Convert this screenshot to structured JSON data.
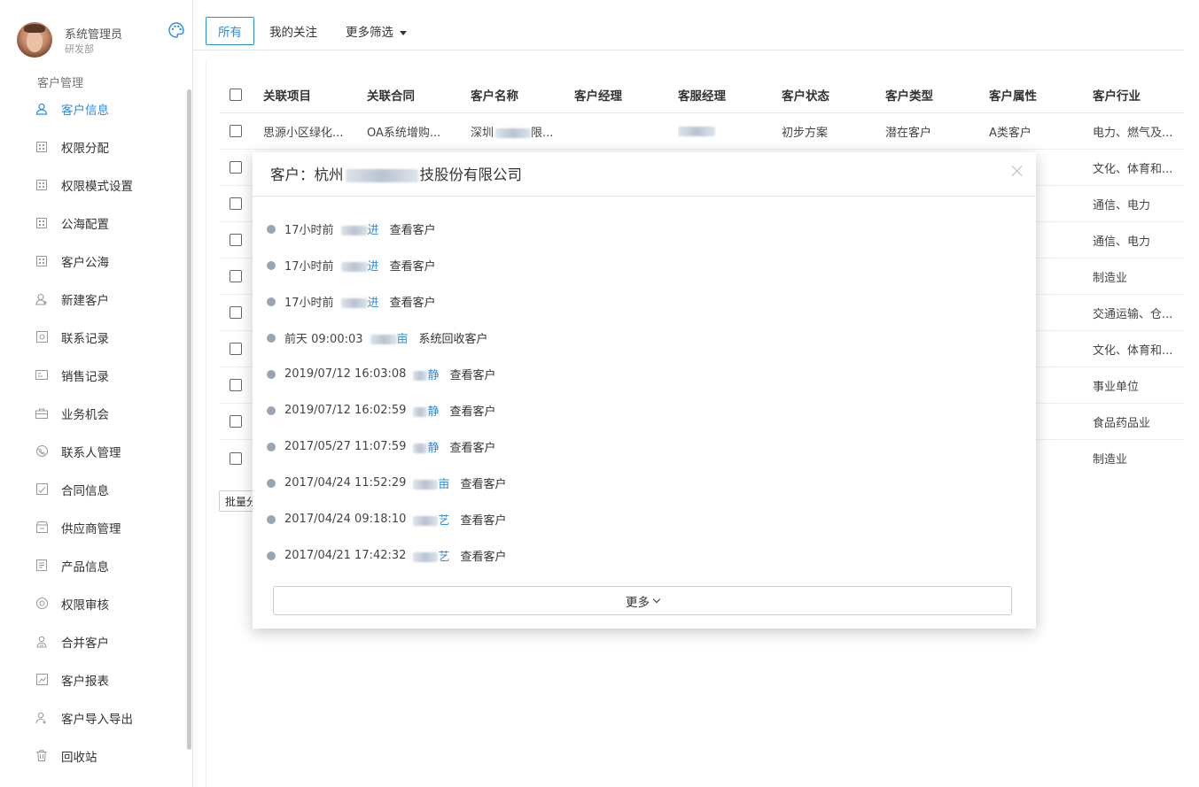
{
  "user": {
    "name": "系统管理员",
    "dept": "研发部"
  },
  "sidebar": {
    "group_title": "客户管理",
    "items": [
      {
        "label": "客户信息",
        "icon": "user-icon",
        "active": true
      },
      {
        "label": "权限分配",
        "icon": "grid-icon"
      },
      {
        "label": "权限模式设置",
        "icon": "grid-icon"
      },
      {
        "label": "公海配置",
        "icon": "grid-icon"
      },
      {
        "label": "客户公海",
        "icon": "grid-icon"
      },
      {
        "label": "新建客户",
        "icon": "user-add-icon"
      },
      {
        "label": "联系记录",
        "icon": "record-icon"
      },
      {
        "label": "销售记录",
        "icon": "card-icon"
      },
      {
        "label": "业务机会",
        "icon": "briefcase-icon"
      },
      {
        "label": "联系人管理",
        "icon": "phone-icon"
      },
      {
        "label": "合同信息",
        "icon": "contract-icon"
      },
      {
        "label": "供应商管理",
        "icon": "supplier-icon"
      },
      {
        "label": "产品信息",
        "icon": "doc-icon"
      },
      {
        "label": "权限审核",
        "icon": "shield-icon"
      },
      {
        "label": "合并客户",
        "icon": "merge-icon"
      },
      {
        "label": "客户报表",
        "icon": "report-icon"
      },
      {
        "label": "客户导入导出",
        "icon": "import-export-icon"
      },
      {
        "label": "回收站",
        "icon": "trash-icon"
      }
    ]
  },
  "topbar": {
    "tab_all": "所有",
    "tab_follow": "我的关注",
    "more_filter": "更多筛选"
  },
  "table": {
    "headers": [
      "关联项目",
      "关联合同",
      "客户名称",
      "客户经理",
      "客服经理",
      "客户状态",
      "客户类型",
      "客户属性",
      "客户行业"
    ],
    "first_row": [
      "思源小区绿化...",
      "OA系统增购...",
      "深圳",
      "",
      "王",
      "初步方案",
      "潜在客户",
      "A类客户",
      "电力、燃气及..."
    ],
    "industries": [
      "电力、燃气及...",
      "文化、体育和...",
      "通信、电力",
      "通信、电力",
      "制造业",
      "交通运输、仓...",
      "文化、体育和...",
      "事业单位",
      "食品药品业",
      "制造业"
    ],
    "batch_label": "批量分"
  },
  "modal": {
    "title": "客户：杭州",
    "title_tail": "技股份有限公司",
    "more_label": "更多",
    "logs": [
      {
        "time": "17小时前",
        "user": "进",
        "action": "查看客户"
      },
      {
        "time": "17小时前",
        "user": "进",
        "action": "查看客户"
      },
      {
        "time": "17小时前",
        "user": "进",
        "action": "查看客户"
      },
      {
        "time": "前天 09:00:03",
        "user": "亩",
        "action": "系统回收客户"
      },
      {
        "time": "2019/07/12 16:03:08",
        "user": "静",
        "action": "查看客户"
      },
      {
        "time": "2019/07/12 16:02:59",
        "user": "静",
        "action": "查看客户"
      },
      {
        "time": "2017/05/27 11:07:59",
        "user": "静",
        "action": "查看客户"
      },
      {
        "time": "2017/04/24 11:52:29",
        "user": "亩",
        "action": "查看客户"
      },
      {
        "time": "2017/04/24 09:18:10",
        "user": "艺",
        "action": "查看客户"
      },
      {
        "time": "2017/04/21 17:42:32",
        "user": "艺",
        "action": "查看客户"
      }
    ]
  }
}
